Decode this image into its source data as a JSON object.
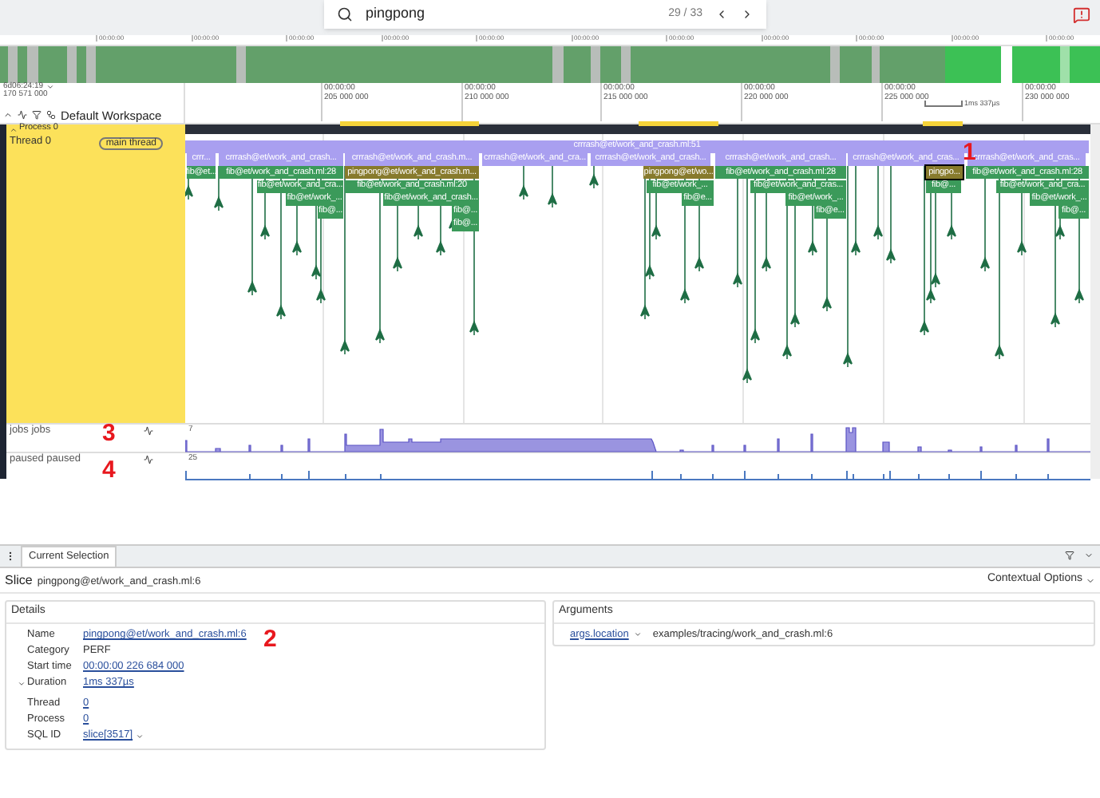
{
  "search": {
    "value": "pingpong",
    "count": "29 / 33"
  },
  "overview": {
    "tick_labels": [
      "00:00:00",
      "00:00:00",
      "00:00:00",
      "00:00:00",
      "00:00:00",
      "00:00:00",
      "00:00:00",
      "00:00:00",
      "00:00:00",
      "00:00:00",
      "00:00:00"
    ]
  },
  "time_axis": {
    "offset": "6d06:24:19",
    "offset_ns": "170 571 000",
    "scale": "1ms 337µs",
    "ticks": [
      {
        "time": "00:00:00",
        "ns": "205 000 000"
      },
      {
        "time": "00:00:00",
        "ns": "210 000 000"
      },
      {
        "time": "00:00:00",
        "ns": "215 000 000"
      },
      {
        "time": "00:00:00",
        "ns": "220 000 000"
      },
      {
        "time": "00:00:00",
        "ns": "225 000 000"
      },
      {
        "time": "00:00:00",
        "ns": "230 000 000"
      }
    ]
  },
  "workspace": "Default Workspace",
  "process": {
    "name": "Process 0",
    "expanded": true
  },
  "thread": {
    "name": "Thread 0",
    "tag": "main thread",
    "slices": [
      {
        "label": "crrrash@et/work_and_crash.ml:51",
        "kind": "crash",
        "selected": false
      },
      {
        "label": "crrr...",
        "kind": "crash",
        "selected": false
      },
      {
        "label": "crrrash@et/work_and_crash...",
        "kind": "crash",
        "selected": false
      },
      {
        "label": "crrrash@et/work_and_crash.m...",
        "kind": "crash",
        "selected": false
      },
      {
        "label": "crrrash@et/work_and_cra...",
        "kind": "crash",
        "selected": false
      },
      {
        "label": "crrrash@et/work_and_crash...",
        "kind": "crash",
        "selected": false
      },
      {
        "label": "crrrash@et/work_and_crash...",
        "kind": "crash",
        "selected": false
      },
      {
        "label": "crrrash@et/work_and_cras...",
        "kind": "crash",
        "selected": false
      },
      {
        "label": "crrrash@et/work_and_cras...",
        "kind": "crash",
        "selected": false
      },
      {
        "label": "fib@et...",
        "kind": "fib",
        "selected": false
      },
      {
        "label": "fib@et/work_and_crash.ml:28",
        "kind": "fib",
        "selected": false
      },
      {
        "label": "pingpong@et/work_and_crash.m...",
        "kind": "pingpong",
        "selected": false
      },
      {
        "label": "pingpong@et/wo...",
        "kind": "pingpong",
        "selected": false
      },
      {
        "label": "fib@et/work_and_crash.ml:28",
        "kind": "fib",
        "selected": false
      },
      {
        "label": "pingpo...",
        "kind": "pingpong",
        "selected": true
      },
      {
        "label": "fib@et/work_and_crash.ml:28",
        "kind": "fib",
        "selected": false
      },
      {
        "label": "fib@et/work_and_cra...",
        "kind": "fib",
        "selected": false
      },
      {
        "label": "fib@et/work_and_crash.ml:20",
        "kind": "fib",
        "selected": false
      },
      {
        "label": "fib@et/work_...",
        "kind": "fib",
        "selected": false
      },
      {
        "label": "fib@et/work_and_cras...",
        "kind": "fib",
        "selected": false
      },
      {
        "label": "fib@...",
        "kind": "fib",
        "selected": false
      },
      {
        "label": "fib@et/work_and_cra...",
        "kind": "fib",
        "selected": false
      },
      {
        "label": "fib@et/work_...",
        "kind": "fib",
        "selected": false
      },
      {
        "label": "fib@et/work_and_crash...",
        "kind": "fib",
        "selected": false
      },
      {
        "label": "fib@e...",
        "kind": "fib",
        "selected": false
      },
      {
        "label": "fib@et/work_...",
        "kind": "fib",
        "selected": false
      },
      {
        "label": "fib@et/work_...",
        "kind": "fib",
        "selected": false
      },
      {
        "label": "fib@...",
        "kind": "fib",
        "selected": false
      },
      {
        "label": "fib@...",
        "kind": "fib",
        "selected": false
      },
      {
        "label": "fib@e...",
        "kind": "fib",
        "selected": false
      },
      {
        "label": "fib@...",
        "kind": "fib",
        "selected": false
      },
      {
        "label": "fib@...",
        "kind": "fib",
        "selected": false
      }
    ]
  },
  "counters": [
    {
      "name": "jobs jobs",
      "max": "7"
    },
    {
      "name": "paused paused",
      "max": "25"
    }
  ],
  "annotations": [
    {
      "label": "1"
    },
    {
      "label": "2"
    },
    {
      "label": "3"
    },
    {
      "label": "4"
    }
  ],
  "panel": {
    "tabs": [
      {
        "label": "Current Selection",
        "selected": true
      }
    ],
    "title": "Slice",
    "subtitle": "pingpong@et/work_and_crash.ml:6",
    "options": "Contextual Options",
    "details": {
      "title": "Details",
      "rows": [
        {
          "label": "Name",
          "value": "pingpong@et/work_and_crash.ml:6",
          "kind": "link"
        },
        {
          "label": "Category",
          "value": "PERF",
          "kind": "plain"
        },
        {
          "label": "Start time",
          "value": "00:00:00 226 684 000",
          "kind": "link"
        },
        {
          "label": "Duration",
          "value": "1ms 337µs",
          "kind": "expander",
          "expanded": true
        },
        {
          "label": "Thread",
          "value": "0",
          "kind": "link"
        },
        {
          "label": "Process",
          "value": "0",
          "kind": "link"
        },
        {
          "label": "SQL ID",
          "value": "slice[3517]",
          "kind": "menu"
        }
      ]
    },
    "arguments": {
      "title": "Arguments",
      "rows": [
        {
          "key": "args.location",
          "value": "examples/tracing/work_and_crash.ml:6"
        }
      ]
    }
  }
}
